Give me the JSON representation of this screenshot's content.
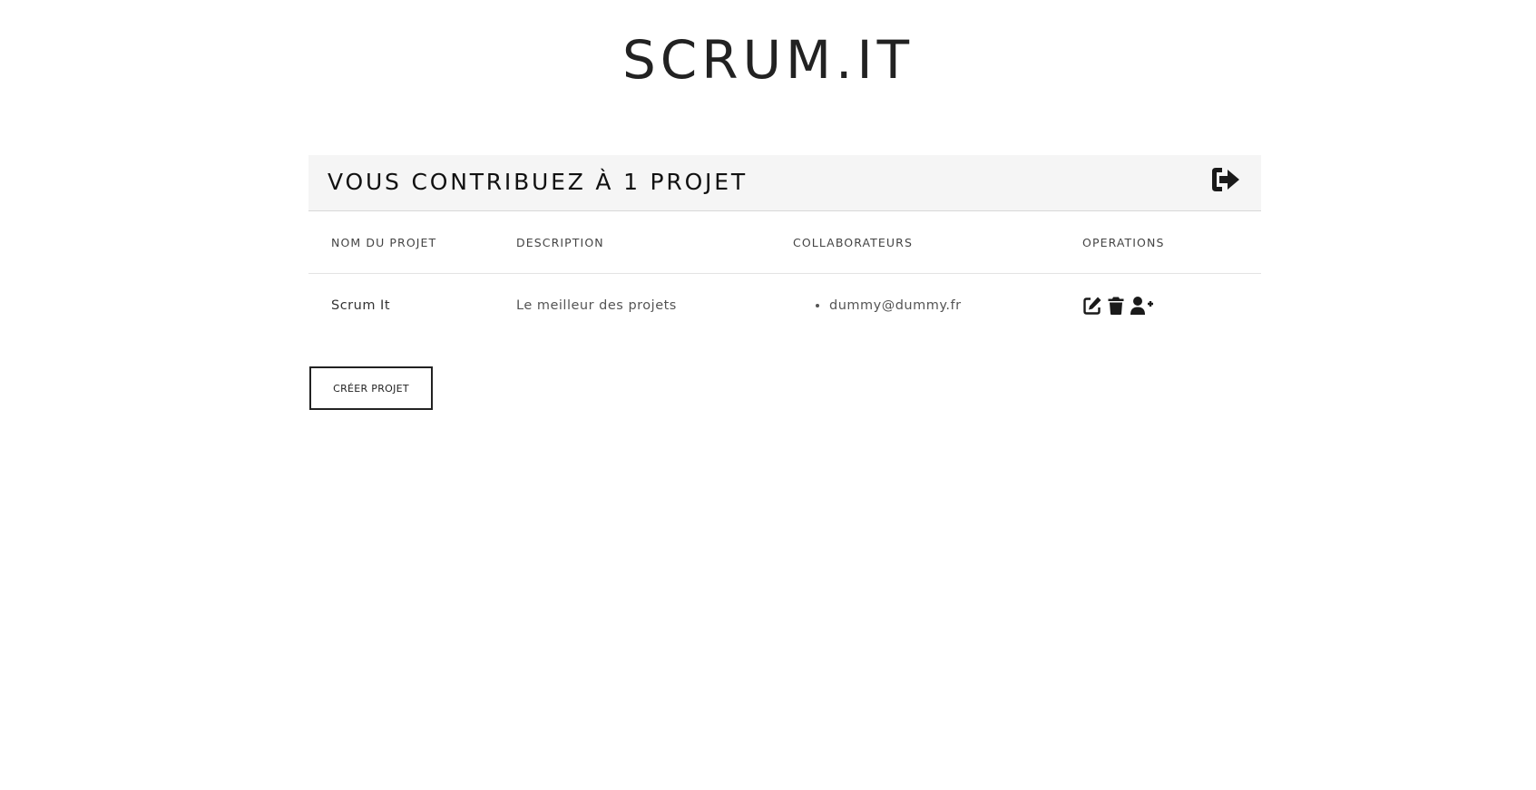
{
  "app": {
    "title": "SCRUM.IT"
  },
  "panel": {
    "heading": "VOUS CONTRIBUEZ À 1 PROJET",
    "logout_icon": "sign-out-icon"
  },
  "table": {
    "columns": [
      "NOM DU PROJET",
      "DESCRIPTION",
      "COLLABORATEURS",
      "OPERATIONS"
    ],
    "rows": [
      {
        "name": "Scrum It",
        "description": "Le meilleur des projets",
        "collaborators": [
          "dummy@dummy.fr"
        ],
        "operations": [
          "edit-icon",
          "trash-icon",
          "user-plus-icon"
        ]
      }
    ]
  },
  "actions": {
    "create_label": "CRÉER PROJET"
  }
}
